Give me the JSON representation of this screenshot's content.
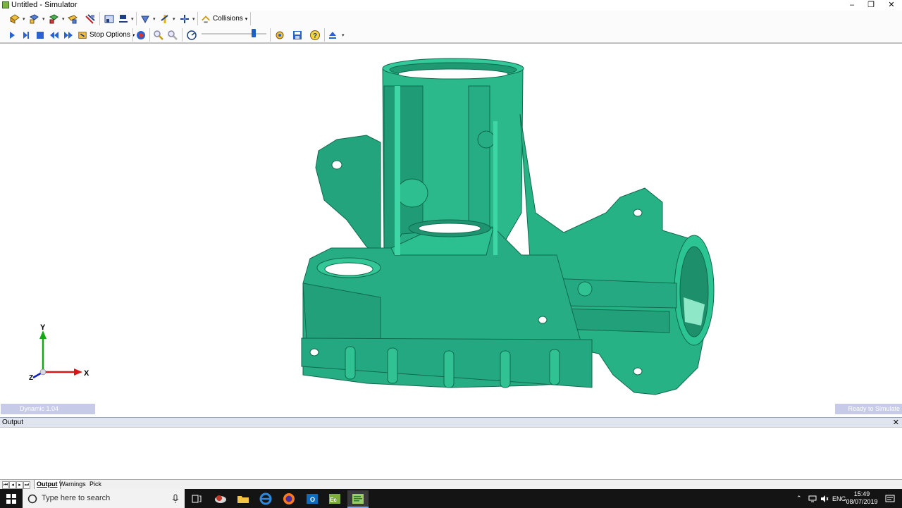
{
  "window": {
    "title": "Untitled - Simulator",
    "minimize": "–",
    "restore": "❐",
    "close": "✕"
  },
  "toolbar1": {
    "collisions_label": "Collisions"
  },
  "toolbar2": {
    "stop_options_label": "Stop Options",
    "speed_slider_value": 0.8
  },
  "viewport": {
    "axis_y": "Y",
    "axis_x": "X",
    "axis_z": "Z",
    "status_left": "Dynamic 1.04",
    "status_right": "Ready to Simulate",
    "model_color": "#2fbf92"
  },
  "output": {
    "title": "Output",
    "close": "✕"
  },
  "bottom_tabs": [
    "Output",
    "Warnings",
    "Pick"
  ],
  "taskbar": {
    "search_placeholder": "Type here to search",
    "lang": "ENG",
    "time": "15:49",
    "date": "08/07/2019"
  }
}
